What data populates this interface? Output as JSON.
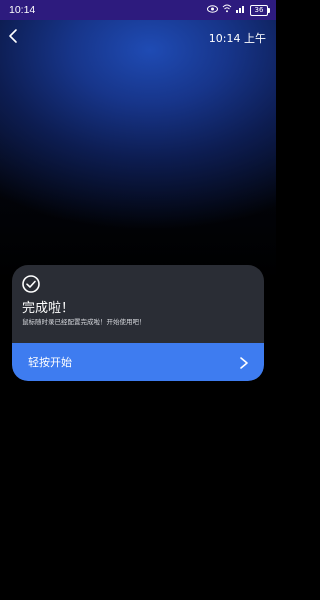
{
  "status_bar": {
    "time": "10:14",
    "battery": "36"
  },
  "header": {
    "clock": "10:14 上午"
  },
  "card": {
    "title": "完成啦！",
    "subtitle": "鼠标随时录已经配置完成啦！开始使用吧！",
    "start_button_label": "轻按开始"
  },
  "colors": {
    "card_bg": "#2a2d35",
    "button_bg": "#3e7cf0",
    "status_bar_bg": "#2d1b7e"
  },
  "icons": [
    "back-arrow-icon",
    "check-circle-icon",
    "chevron-right-icon",
    "eye-icon",
    "wifi-icon",
    "signal-icon",
    "battery-icon"
  ]
}
